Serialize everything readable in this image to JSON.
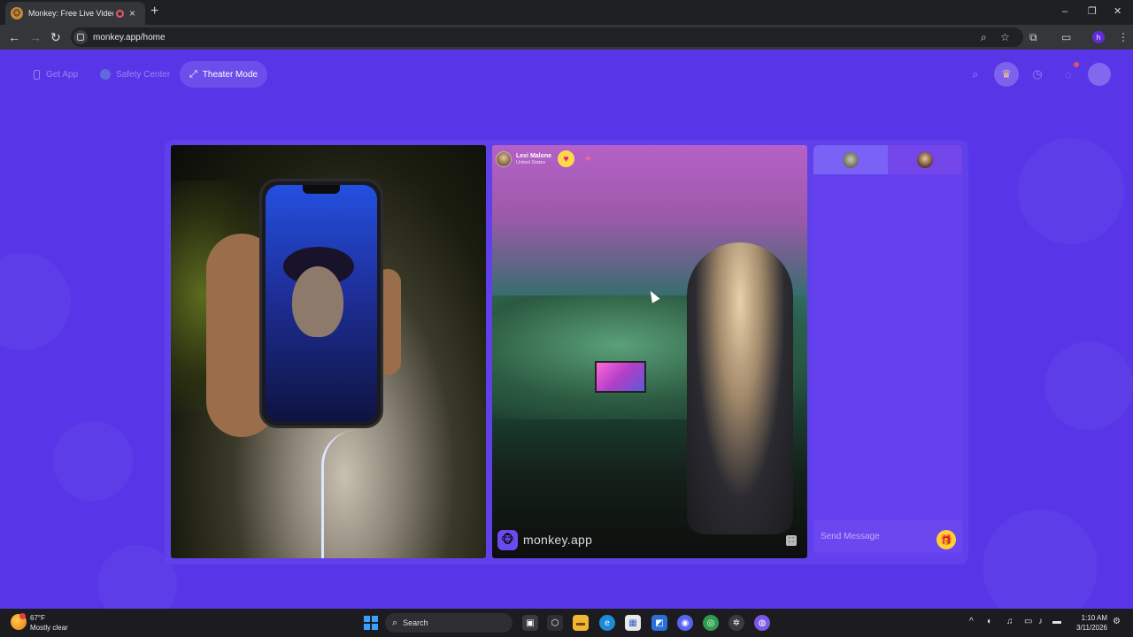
{
  "browser": {
    "tab_title": "Monkey: Free Live Video Chat",
    "new_tab_symbol": "+",
    "tab_close_symbol": "×",
    "url": "monkey.app/home",
    "window_controls": [
      "–",
      "❐",
      "✕"
    ]
  },
  "nav": {
    "get_app": "Get App",
    "safety_center": "Safety Center",
    "theater_mode": "Theater Mode"
  },
  "remote_user": {
    "name": "Lexi Malone",
    "country": "United States"
  },
  "watermark": {
    "text": "monkey.app"
  },
  "chat": {
    "placeholder": "Send Message"
  },
  "taskbar": {
    "weather_temp": "67°F",
    "weather_desc": "Mostly clear",
    "search_label": "Search",
    "time": "1:10 AM",
    "date": "3/11/2026"
  },
  "colors": {
    "page_bg": "#5836e8",
    "chat_panel": "#6540ef",
    "gift_button": "#ffcf33",
    "heart_badge": "#ffd84a",
    "browser_toolbar": "#35363a"
  },
  "icons": {
    "nav": [
      "phone-icon",
      "shield-icon",
      "theater-mode-icon"
    ],
    "top_right": [
      "search-icon",
      "crown-icon",
      "history-icon",
      "messages-icon",
      "avatar"
    ],
    "taskbar_apps": [
      "windows-icon",
      "task-view-icon",
      "copilot-icon",
      "file-explorer-icon",
      "edge-icon",
      "store-icon",
      "editor-icon",
      "discord-icon",
      "chrome-icon",
      "chatgpt-icon",
      "app-icon"
    ]
  }
}
